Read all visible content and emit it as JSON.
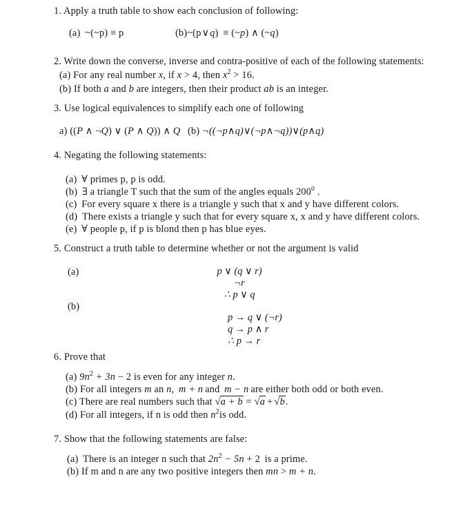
{
  "document": {
    "type": "worksheet",
    "title_visible": false,
    "text_color": "#18181e",
    "background": "#ffffff"
  },
  "questions": [
    {
      "number": "1.",
      "prompt": "1. Apply a truth table to show each conclusion of following:",
      "items": [
        {
          "label": "(a)",
          "text": "~(~p) ≡ p"
        },
        {
          "label": "(b)",
          "text": "~(p ∨ q)  ≡ (~p) ∧ (~q)"
        }
      ]
    },
    {
      "number": "2.",
      "prompt": "2. Write down the converse, inverse and contra-positive of each of the following statements:",
      "items": [
        {
          "label": "(a)",
          "text": "For any real number x , if x > 4, then x² > 16 ."
        },
        {
          "label": "(b)",
          "text": "If both a and b are integers, then their product ab is an integer."
        }
      ]
    },
    {
      "number": "3.",
      "prompt": "3. Use logical equivalences to simplify each one of following",
      "items": [
        {
          "label": "a)",
          "text": "((P ∧ ¬Q) ∨ (P ∧ Q)) ∧ Q"
        },
        {
          "label": "(b)",
          "text": "¬((¬p ∧ q) ∨ (¬p ∧ ¬q)) ∨ (p ∧ q)"
        }
      ]
    },
    {
      "number": "4.",
      "prompt": "4. Negating the following statements:",
      "items": [
        {
          "label": "(a)",
          "text": "∀ primes p, p is odd."
        },
        {
          "label": "(b)",
          "text": "∃ a triangle T such that the sum of the angles equals 200° ."
        },
        {
          "label": "(c)",
          "text": "For every square x there is a triangle y such that x and y have different colors."
        },
        {
          "label": "(d)",
          "text": "There exists a triangle y such that for every square x, x and y have different colors."
        },
        {
          "label": "(e)",
          "text": "∀ people p, if p is blond then p has blue eyes."
        }
      ]
    },
    {
      "number": "5.",
      "prompt": "5. Construct a truth table to determine whether or not the argument is valid",
      "items": [
        {
          "label": "(a)",
          "text": ""
        },
        {
          "label": "(b)",
          "text": ""
        }
      ],
      "arguments": [
        {
          "label": "(a)",
          "premises": [
            "p ∨ (q ∨ r)",
            "¬r"
          ],
          "conclusion": "∴ p ∨ q"
        },
        {
          "label": "(b)",
          "premises": [
            "p → q ∨ (¬r)",
            "q → p ∧ r"
          ],
          "conclusion": "∴ p → r"
        }
      ]
    },
    {
      "number": "6.",
      "prompt": "6. Prove that",
      "items": [
        {
          "label": "(a)",
          "text": "9n² + 3n − 2 is even for any integer n ."
        },
        {
          "label": "(b)",
          "text": "For all integers m an n,  m + n and  m − n are either both odd or both even."
        },
        {
          "label": "(c)",
          "text": "There are real numbers such that √(a + b) = √a + √b."
        },
        {
          "label": "(d)",
          "text": "For all integers, if n is odd then n²is odd."
        }
      ]
    },
    {
      "number": "7.",
      "prompt": "7. Show that the following statements are false:",
      "items": [
        {
          "label": "(a)",
          "text": "There is an integer n such that 2n² − 5n + 2  is a prime."
        },
        {
          "label": "(b)",
          "text": "If m and n are any two positive integers then mn > m + n."
        }
      ]
    }
  ],
  "labels": {
    "q1a": "(a)",
    "q1b": "(b)",
    "q2a": "(a)",
    "q2b": "(b)",
    "q3a": "a)",
    "q3b": "(b)",
    "q4a": "(a)",
    "q4b": "(b)",
    "q4c": "(c)",
    "q4d": "(d)",
    "q4e": "(e)",
    "q5a": "(a)",
    "q5b": "(b)",
    "q6a": "(a)",
    "q6b": "(b)",
    "q6c": "(c)",
    "q6d": "(d)",
    "q7a": "(a)",
    "q7b": "(b)"
  },
  "prompts": {
    "q1": "1. Apply a truth table to show each conclusion of following:",
    "q2": "2. Write down the converse, inverse and contra-positive of each of the following statements:",
    "q3": "3. Use logical equivalences to simplify each one of following",
    "q4": "4. Negating the following statements:",
    "q5": "5. Construct a truth table to determine whether or not the argument is valid",
    "q6": "6. Prove that",
    "q7": "7. Show that the following statements are false:"
  },
  "fragments": {
    "q2a_pre": "For any real number",
    "q2a_x1": "x",
    "q2a_mid1": ", if",
    "q2a_x2": "x",
    "q2a_gt4": "> 4,",
    "q2a_then": "then",
    "q2a_x3": "x",
    "q2a_exp": "2",
    "q2a_gt16": "> 16",
    "q2a_end": ".",
    "q2b_pre": "If both",
    "q2b_a": "a",
    "q2b_and": "and",
    "q2b_b": "b",
    "q2b_mid": "are integers, then their product",
    "q2b_ab": "ab",
    "q2b_end": "is an integer.",
    "q4a": "∀ primes p, p is odd.",
    "q4b_pre": "∃ a triangle T such that the sum of the angles equals",
    "q4b_num": "200",
    "q4b_deg": "0",
    "q4b_end": ".",
    "q4c": "For every square x there is a triangle y such that x and y have different colors.",
    "q4d": "There exists a triangle y such that for every square x, x and y have different colors.",
    "q4e": "∀ people p, if p is blond then p has blue eyes.",
    "q6a_9": "9",
    "q6a_n": "n",
    "q6a_exp": "2",
    "q6a_plus3n": "+ 3",
    "q6a_n2": "n",
    "q6a_minus2": "− 2",
    "q6a_text": "is even for any integer",
    "q6a_nvar": "n",
    "q6a_end": ".",
    "q6b_pre": "For all integers",
    "q6b_m": "m",
    "q6b_an": "an",
    "q6b_n": "n",
    "q6b_comma": ",",
    "q6b_mpn": "m + n",
    "q6b_and": "and",
    "q6b_mmn": "m − n",
    "q6b_end": "are either both odd or both even.",
    "q6c_pre": "There are real numbers such that",
    "q6c_r1a": "a + b",
    "q6c_eq": "=",
    "q6c_r2a": "a",
    "q6c_plus": "+",
    "q6c_r3b": "b",
    "q6c_end": ".",
    "q6d_pre": "For all integers, if n is odd then",
    "q6d_n": "n",
    "q6d_exp": "2",
    "q6d_end": "is odd.",
    "q7a_pre": "There is an integer n such that",
    "q7a_2": "2",
    "q7a_n": "n",
    "q7a_exp": "2",
    "q7a_m5n": "− 5",
    "q7a_n2": "n",
    "q7a_p2": "+ 2",
    "q7a_end": "is a prime.",
    "q7b_pre": "If m and n are any two positive integers then",
    "q7b_mn": "mn",
    "q7b_gt": ">",
    "q7b_m": "m + n",
    "q7b_end": ".",
    "q1a_expr": "~(~p) ≡ p",
    "q1b_pre": "~(p",
    "q1b_or": "∨",
    "q1b_q": "q",
    "q1b_close": ")",
    "q1b_equiv": "≡",
    "q1b_np": "(~p)",
    "q1b_and": "∧",
    "q1b_nq": "(~q)",
    "q3a_expr": "((P ∧ ¬Q) ∨ (P ∧ Q)) ∧ Q",
    "q3b_expr": "¬((¬p ∧ q) ∨ (¬p ∧ ¬q)) ∨ (p ∧ q)",
    "q5a_p1": "p ∨ (q ∨ r)",
    "q5a_p2": "¬r",
    "q5a_c": "∴ p ∨ q",
    "q5b_p1": "p → q ∨ (¬r)",
    "q5b_p2": "q → p ∧ r",
    "q5b_c": "∴ p → r"
  }
}
